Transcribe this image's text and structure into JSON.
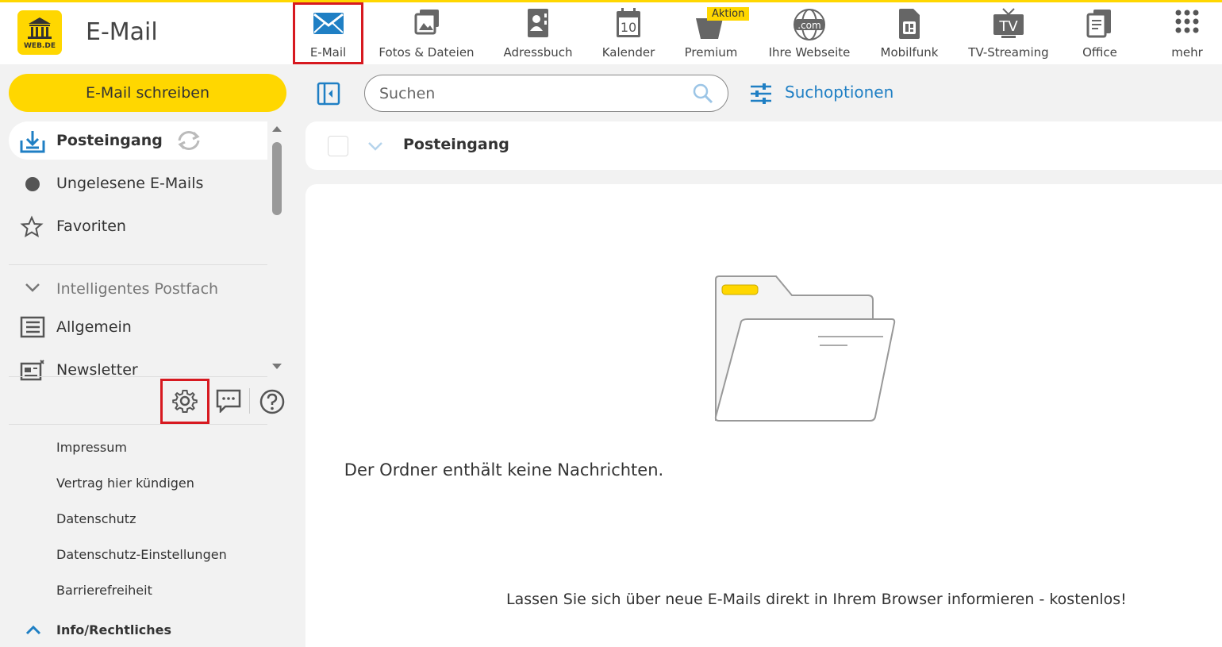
{
  "header": {
    "logo_text": "WEB.DE",
    "app_title": "E-Mail",
    "nav": [
      {
        "label": "E-Mail",
        "icon": "envelope-icon"
      },
      {
        "label": "Fotos & Dateien",
        "icon": "photos-icon"
      },
      {
        "label": "Adressbuch",
        "icon": "address-book-icon"
      },
      {
        "label": "Kalender",
        "icon": "calendar-icon",
        "day": "10"
      },
      {
        "label": "Premium",
        "icon": "premium-icon",
        "badge": "Aktion"
      },
      {
        "label": "Ihre Webseite",
        "icon": "globe-icon",
        "globe_text": ".com"
      },
      {
        "label": "Mobilfunk",
        "icon": "sim-card-icon"
      },
      {
        "label": "TV-Streaming",
        "icon": "tv-icon",
        "tv_text": "TV"
      },
      {
        "label": "Office",
        "icon": "office-icon"
      },
      {
        "label": "mehr",
        "icon": "apps-grid-icon"
      }
    ]
  },
  "sidebar": {
    "compose_label": "E-Mail schreiben",
    "folders": [
      {
        "label": "Posteingang",
        "icon": "inbox-icon"
      },
      {
        "label": "Ungelesene E-Mails",
        "icon": "unread-dot-icon"
      },
      {
        "label": "Favoriten",
        "icon": "star-icon"
      }
    ],
    "section_label": "Intelligentes Postfach",
    "smart_folders": [
      {
        "label": "Allgemein",
        "icon": "list-icon"
      },
      {
        "label": "Newsletter",
        "icon": "newsletter-icon"
      }
    ],
    "footer_links": [
      "Impressum",
      "Vertrag hier kündigen",
      "Datenschutz",
      "Datenschutz-Einstellungen",
      "Barrierefreiheit"
    ],
    "info_label": "Info/Rechtliches"
  },
  "toolbar": {
    "search_placeholder": "Suchen",
    "search_options_label": "Suchoptionen"
  },
  "list": {
    "folder_title": "Posteingang",
    "empty_message": "Der Ordner enthält keine Nachrichten.",
    "notify_message": "Lassen Sie sich über neue E-Mails direkt in Ihrem Browser informieren - kostenlos!"
  },
  "colors": {
    "brand_yellow": "#ffd700",
    "accent_blue": "#1f7fc4",
    "highlight_red": "#d71920"
  }
}
